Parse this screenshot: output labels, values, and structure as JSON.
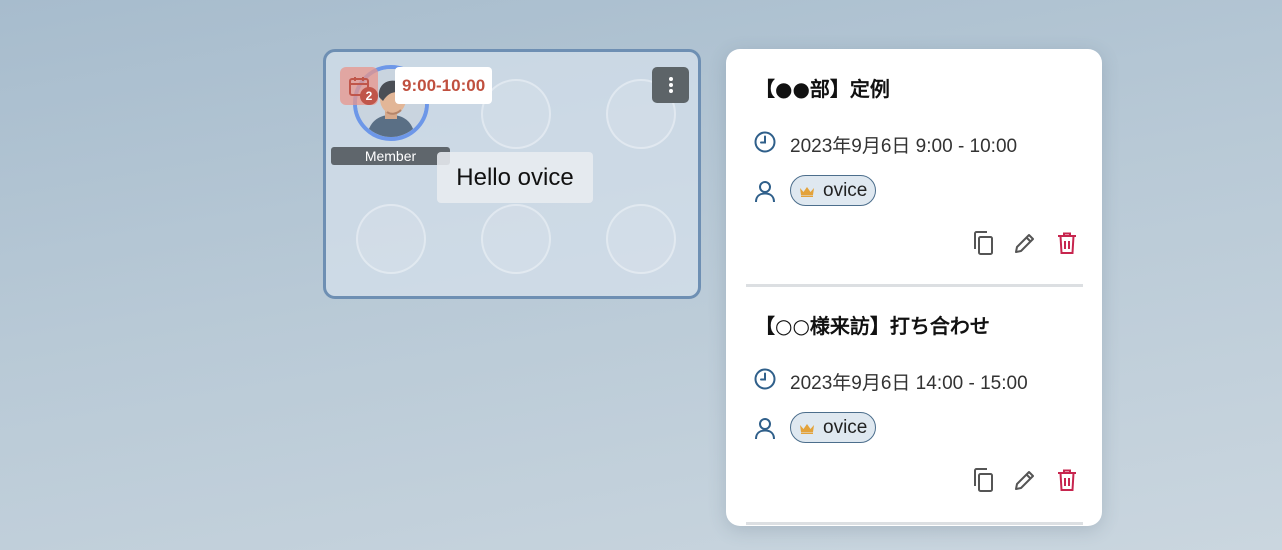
{
  "room": {
    "avatar": {
      "calendar_icon": "calendar-icon",
      "event_count": "2",
      "time_chip": "9:00-10:00",
      "role": "Member"
    },
    "speech_bubble": "Hello ovice",
    "menu_icon": "more-vertical-icon"
  },
  "events": [
    {
      "title": "【●●部】定例",
      "time": "2023年9月6日 9:00 - 10:00",
      "participant": "ovice"
    },
    {
      "title": "【○○様来訪】打ち合わせ",
      "time": "2023年9月6日 14:00 - 15:00",
      "participant": "ovice"
    }
  ],
  "icons": {
    "clock": "clock-icon",
    "user": "user-icon",
    "crown": "crown-icon",
    "copy": "copy-icon",
    "edit": "pencil-icon",
    "delete": "trash-icon"
  },
  "colors": {
    "time_chip_text": "#c0503f",
    "avatar_ring": "#6d97e8",
    "room_border": "#6e8fb3",
    "delete_icon": "#c7254e",
    "crown": "#e3a23a",
    "icon_blue": "#2f5f8a"
  }
}
